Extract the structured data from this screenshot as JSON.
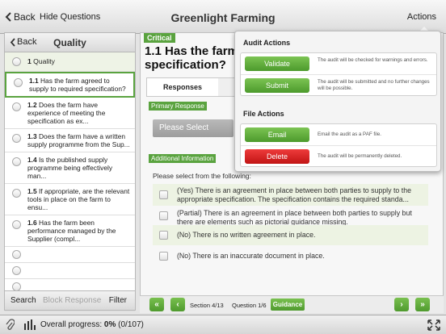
{
  "navbar": {
    "back": "Back",
    "hide": "Hide Questions",
    "title": "Greenlight Farming",
    "actions": "Actions"
  },
  "left": {
    "back": "Back",
    "title": "Quality",
    "section": {
      "num": "1",
      "label": "Quality"
    },
    "items": [
      {
        "num": "1.1",
        "text": "Has the farm agreed to supply to required specification?"
      },
      {
        "num": "1.2",
        "text": "Does the farm have experience of meeting the specification as ex..."
      },
      {
        "num": "1.3",
        "text": "Does the farm have a written supply programme from the Sup..."
      },
      {
        "num": "1.4",
        "text": "Is the published supply programme being effectively man..."
      },
      {
        "num": "1.5",
        "text": "If appropriate, are the relevant tools in place on the farm to ensu..."
      },
      {
        "num": "1.6",
        "text": "Has the farm been performance managed by the Supplier (compl..."
      }
    ],
    "footer": {
      "search": "Search",
      "block": "Block Response",
      "filter": "Filter"
    }
  },
  "main": {
    "critical": "Critical",
    "question_title": "1.1 Has the farm specification?",
    "tabs": [
      "Responses",
      ""
    ],
    "primary_label": "Primary Response",
    "select_placeholder": "Please Select",
    "additional_label": "Additional Information",
    "please": "Please select from the following:",
    "options": [
      "(Yes) There is an agreement in place between both parties to supply to the appropriate specification. The specification contains the required standa...",
      "(Partial) There is an agreement in place between both parties to supply but there are elements such as pictorial guidance missing.",
      "(No) There is no written agreement in place.",
      "(No) There is an inaccurate document in place."
    ]
  },
  "bottom": {
    "first": "«",
    "prev": "‹",
    "section": "Section 4/13",
    "question": "Question 1/6",
    "guidance": "Guidance",
    "next": "›",
    "last": "»"
  },
  "status": {
    "label": "Overall progress:",
    "value": "0%",
    "count": "(0/107)"
  },
  "popover": {
    "audit_title": "Audit Actions",
    "validate": "Validate",
    "validate_desc": "The audit will be checked for warnings and errors.",
    "submit": "Submit",
    "submit_desc": "The audit will be submitted and no further changes will be possible.",
    "file_title": "File Actions",
    "email": "Email",
    "email_desc": "Email the audit as a PAF file.",
    "delete": "Delete",
    "delete_desc": "The audit will be permanently deleted."
  },
  "colors": {
    "accent": "#5aa33f",
    "danger": "#d32020"
  }
}
